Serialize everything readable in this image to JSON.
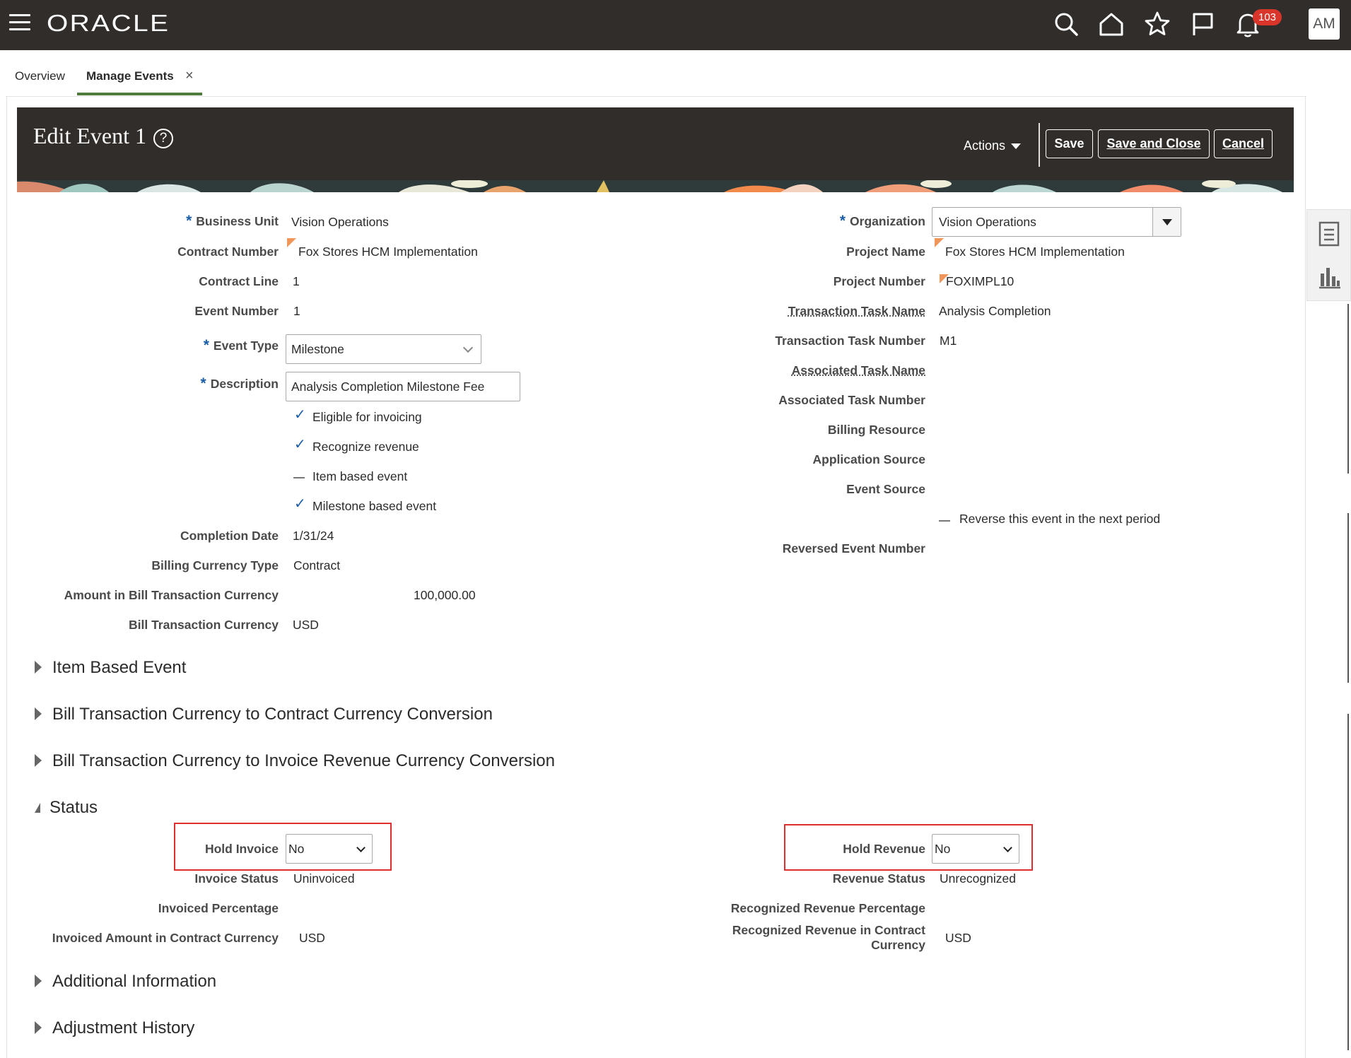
{
  "topbar": {
    "logo": "ORACLE",
    "notification_count": "103",
    "user_initials": "AM",
    "icons": [
      "menu-icon",
      "search-icon",
      "home-icon",
      "star-icon",
      "flag-icon",
      "bell-icon"
    ]
  },
  "tabs": [
    {
      "label": "Overview"
    },
    {
      "label": "Manage Events",
      "active": true
    }
  ],
  "header": {
    "title": "Edit Event 1",
    "actions_label": "Actions",
    "save_label": "Save",
    "save_close_label": "Save and Close",
    "cancel_label": "Cancel"
  },
  "left_fields": {
    "business_unit": {
      "label": "Business Unit",
      "value": "Vision Operations"
    },
    "contract_number": {
      "label": "Contract Number",
      "value": "Fox Stores HCM Implementation"
    },
    "contract_line": {
      "label": "Contract Line",
      "value": "1"
    },
    "event_number": {
      "label": "Event Number",
      "value": "1"
    },
    "event_type": {
      "label": "Event Type",
      "value": "Milestone"
    },
    "description": {
      "label": "Description",
      "value": "Analysis Completion Milestone Fee"
    },
    "checkboxes": [
      {
        "label": "Eligible for invoicing",
        "checked": true
      },
      {
        "label": "Recognize revenue",
        "checked": true
      },
      {
        "label": "Item based event",
        "checked": false
      },
      {
        "label": "Milestone based event",
        "checked": true
      }
    ],
    "completion_date": {
      "label": "Completion Date",
      "value": "1/31/24"
    },
    "billing_currency_type": {
      "label": "Billing Currency Type",
      "value": "Contract"
    },
    "amount": {
      "label": "Amount in Bill Transaction Currency",
      "value": "100,000.00"
    },
    "bill_currency": {
      "label": "Bill Transaction Currency",
      "value": "USD"
    }
  },
  "right_fields": {
    "organization": {
      "label": "Organization",
      "value": "Vision Operations"
    },
    "project_name": {
      "label": "Project Name",
      "value": "Fox Stores HCM Implementation"
    },
    "project_number": {
      "label": "Project Number",
      "value": "FOXIMPL10"
    },
    "transaction_task_name": {
      "label": "Transaction Task Name",
      "value": "Analysis Completion"
    },
    "transaction_task_number": {
      "label": "Transaction Task Number",
      "value": "M1"
    },
    "associated_task_name": {
      "label": "Associated Task Name",
      "value": ""
    },
    "associated_task_number": {
      "label": "Associated Task Number",
      "value": ""
    },
    "billing_resource": {
      "label": "Billing Resource",
      "value": ""
    },
    "application_source": {
      "label": "Application Source",
      "value": ""
    },
    "event_source": {
      "label": "Event Source",
      "value": ""
    },
    "reverse_checkbox": {
      "label": "Reverse this event in the next period",
      "checked": false
    },
    "reversed_event_number": {
      "label": "Reversed Event Number",
      "value": ""
    }
  },
  "sections": {
    "item_based": "Item Based Event",
    "bill_to_contract": "Bill Transaction Currency to Contract Currency Conversion",
    "bill_to_invoice": "Bill Transaction Currency to Invoice Revenue Currency Conversion",
    "status": "Status",
    "additional": "Additional Information",
    "adjustment": "Adjustment History"
  },
  "status": {
    "hold_invoice": {
      "label": "Hold Invoice",
      "value": "No"
    },
    "invoice_status": {
      "label": "Invoice Status",
      "value": "Uninvoiced"
    },
    "invoiced_percentage": {
      "label": "Invoiced Percentage",
      "value": ""
    },
    "invoiced_amount": {
      "label": "Invoiced Amount in Contract Currency",
      "value": "USD"
    },
    "hold_revenue": {
      "label": "Hold Revenue",
      "value": "No"
    },
    "revenue_status": {
      "label": "Revenue Status",
      "value": "Unrecognized"
    },
    "recognized_percentage": {
      "label": "Recognized Revenue Percentage",
      "value": ""
    },
    "recognized_revenue_line1": "Recognized Revenue in Contract",
    "recognized_revenue_line2": "Currency",
    "recognized_revenue_value": "USD"
  }
}
